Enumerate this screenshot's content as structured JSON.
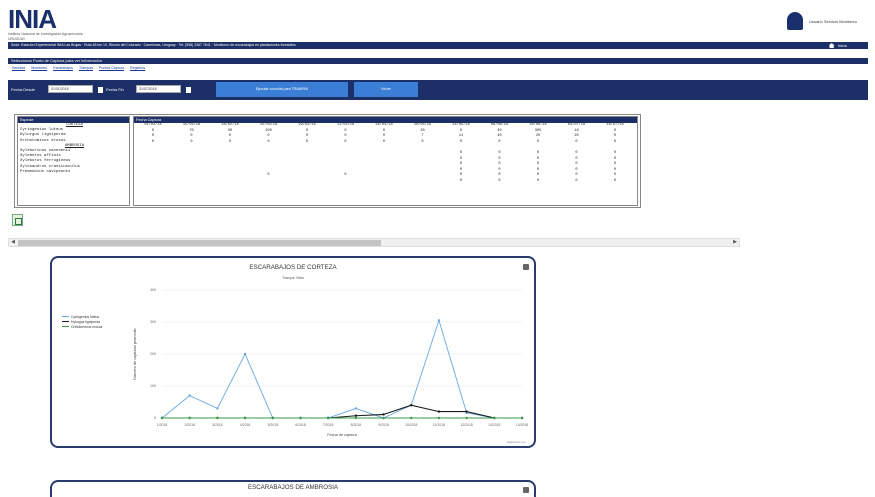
{
  "header": {
    "logo_text": "INIA",
    "logo_sub": "Instituto Nacional de Investigación Agropecuaria · URUGUAY",
    "user_name": "Usuario Servicio Monitoreo",
    "topbar_text": "Sede: Estación Experimental INIA Las Brujas · Ruta 48 km 10, Rincón del Colorado · Canelones, Uruguay · Tel: (598) 2367 7641 · Monitoreo de escarabajos en plantaciones forestales",
    "home_label": "Inicio"
  },
  "section": {
    "title": "Seleccionar Punto de Captura para ver información",
    "nav": [
      "Sanidad",
      "Monitoreo",
      "Escarabajos",
      "Trampas",
      "Puntos Captura",
      "Registros"
    ]
  },
  "filters": {
    "fecha_desde_label": "Fecha Desde",
    "fecha_desde_value": "01/01/2018",
    "fecha_hasta_label": "Fecha Fin",
    "fecha_hasta_value": "31/07/2018",
    "query_button": "Ejecutar consulta para TRAMPAS",
    "reset_button": "Volver"
  },
  "table": {
    "col1_header": "Especie",
    "col2_header": "Fecha Captura",
    "species": [
      {
        "name": "CORTEZA",
        "sub": true
      },
      {
        "name": "Cyrtogenius luteus",
        "sub": false
      },
      {
        "name": "Hylurgus ligniperda",
        "sub": false
      },
      {
        "name": "Orthotomicus erosus",
        "sub": false
      },
      {
        "name": "AMBROSIA",
        "sub": true
      },
      {
        "name": "Xyleborinus saxesenii",
        "sub": false
      },
      {
        "name": "Xyleborus affinis",
        "sub": false
      },
      {
        "name": "Xyleborus ferrugineus",
        "sub": false
      },
      {
        "name": "Xylosandrus crassiusculus",
        "sub": false
      },
      {
        "name": "Premnobius cavipennis",
        "sub": false
      }
    ],
    "dates": [
      "01/02/18",
      "15/02/18",
      "28/02/18",
      "15/03/18",
      "29/03/18",
      "11/04/18",
      "26/04/18",
      "10/05/18",
      "24/05/18",
      "06/06/18",
      "20/06/18",
      "04/07/18",
      "18/07/18"
    ],
    "rows": [
      [
        "0",
        "70",
        "30",
        "200",
        "0",
        "0",
        "0",
        "30",
        "0",
        "40",
        "305",
        "16",
        "0"
      ],
      [
        "0",
        "0",
        "0",
        "0",
        "0",
        "0",
        "0",
        "7",
        "11",
        "40",
        "20",
        "20",
        "0"
      ],
      [
        "0",
        "0",
        "0",
        "0",
        "0",
        "0",
        "0",
        "0",
        "0",
        "0",
        "0",
        "0",
        "0"
      ],
      [
        "",
        "",
        "",
        "",
        "",
        "",
        "",
        "",
        "",
        "",
        "",
        "",
        ""
      ],
      [
        "",
        "",
        "",
        "",
        "",
        "",
        "",
        "",
        "0",
        "0",
        "0",
        "0",
        "0"
      ],
      [
        "",
        "",
        "",
        "",
        "",
        "",
        "",
        "",
        "0",
        "0",
        "0",
        "0",
        "0"
      ],
      [
        "",
        "",
        "",
        "",
        "",
        "",
        "",
        "",
        "0",
        "0",
        "0",
        "0",
        "0"
      ],
      [
        "",
        "",
        "",
        "",
        "",
        "",
        "",
        "",
        "0",
        "0",
        "0",
        "0",
        "0"
      ],
      [
        "",
        "",
        "",
        "0",
        "",
        "0",
        "",
        "",
        "0",
        "0",
        "0",
        "0",
        "0"
      ],
      [
        "",
        "",
        "",
        "",
        "",
        "",
        "",
        "",
        "0",
        "0",
        "0",
        "0",
        "0"
      ]
    ]
  },
  "chart1": {
    "title": "ESCARABAJOS DE CORTEZA",
    "subtitle": "Trampa: Nido",
    "credit": "Highcharts.com"
  },
  "chart2": {
    "title": "ESCARABAJOS DE AMBROSIA"
  },
  "chart_data": {
    "type": "line",
    "title": "ESCARABAJOS DE CORTEZA",
    "subtitle": "Trampa: Nido",
    "xlabel": "Fecha de captura",
    "ylabel": "Número de capturas promedio",
    "ylim": [
      0,
      400
    ],
    "yticks": [
      0,
      100,
      200,
      300,
      400
    ],
    "categories": [
      "1/2018",
      "2/2018",
      "3/2018",
      "4/2018",
      "5/2018",
      "6/2018",
      "7/2018",
      "8/2018",
      "9/2018",
      "10/2018",
      "11/2018",
      "12/2018",
      "13/2018",
      "14/2018"
    ],
    "legend_position": "left",
    "series": [
      {
        "name": "Cyrtogenius luteus",
        "color": "#6aa8e0",
        "values": [
          0,
          70,
          30,
          200,
          0,
          0,
          0,
          30,
          0,
          40,
          305,
          16,
          0,
          0
        ]
      },
      {
        "name": "Hylurgus ligniperda",
        "color": "#1b1b1b",
        "values": [
          0,
          0,
          0,
          0,
          0,
          0,
          0,
          7,
          11,
          40,
          20,
          20,
          0,
          0
        ]
      },
      {
        "name": "Orthotomicus erosus",
        "color": "#3a9a4a",
        "values": [
          0,
          0,
          0,
          0,
          0,
          0,
          0,
          0,
          0,
          0,
          0,
          0,
          0,
          0
        ]
      }
    ]
  }
}
